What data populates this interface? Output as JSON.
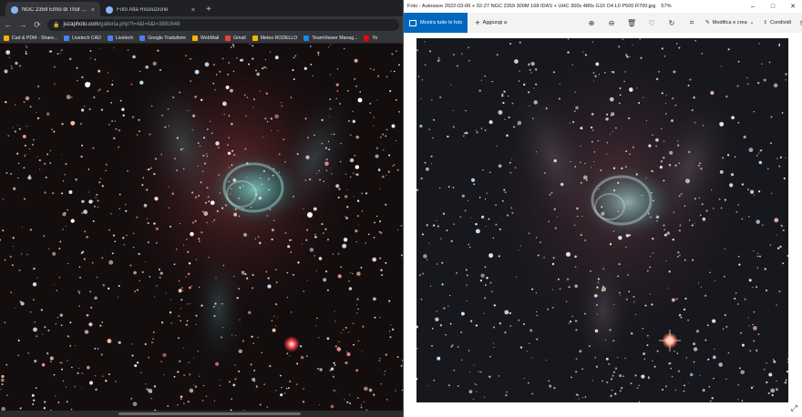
{
  "browser": {
    "tabs": [
      {
        "title": "NGC 2359 Elmo di Thor | JuzaPh...",
        "close": "×",
        "active": true
      },
      {
        "title": "Foto Alta Risoluzione",
        "close": "×",
        "active": false
      }
    ],
    "new_tab": "+",
    "address": {
      "host": "juzaphoto.com",
      "path": "/galleria.php?t=4&l=it&t=3891648"
    },
    "bookmarks": [
      {
        "label": "Cad & PDM - Share...",
        "color": "#f4b400"
      },
      {
        "label": "Livetech CAD",
        "color": "#4285f4"
      },
      {
        "label": "Livetech",
        "color": "#4285f4"
      },
      {
        "label": "Google Traduttore",
        "color": "#4285f4"
      },
      {
        "label": "WebMail",
        "color": "#f4b400"
      },
      {
        "label": "Gmail",
        "color": "#ea4335"
      },
      {
        "label": "Meteo RODELLO",
        "color": "#f4b400"
      },
      {
        "label": "TeamViewer Manag...",
        "color": "#0e8ee9"
      },
      {
        "label": "Yo",
        "color": "#ff0000"
      }
    ]
  },
  "photos": {
    "window_title": "Foto - Autosave 2022-03-06 + 02-27 NGC 2359 300M 168 IDAS + UHC 300s 480s G10 O4 L0 P500 R700.jpg",
    "zoom": "57%",
    "window_controls": {
      "minimize": "–",
      "maximize": "□",
      "close": "✕"
    },
    "toolbar": {
      "all_photos": "Mostra tutte le foto",
      "add_to": "Aggiungi a",
      "edit_create": "Modifica e crea",
      "share": "Condividi"
    }
  },
  "colors": {
    "accent": "#0067c0",
    "browser_bg": "#202124",
    "toolbar_bg": "#35363a",
    "nebula_teal": "#5fb8b4",
    "nebula_red": "#b04a4a"
  },
  "icons": {
    "back": "arrow-left-icon",
    "forward": "arrow-right-icon",
    "reload": "reload-icon",
    "zoom_in": "zoom-in-icon",
    "zoom_out": "zoom-out-icon",
    "delete": "trash-icon",
    "favorite": "heart-icon",
    "rotate": "rotate-icon",
    "crop": "crop-icon",
    "print": "printer-icon",
    "expand": "expand-icon"
  }
}
